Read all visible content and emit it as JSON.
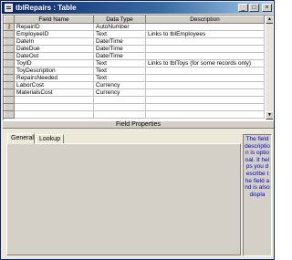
{
  "window": {
    "title": "tblRepairs : Table",
    "min_glyph": "_",
    "max_glyph": "□",
    "close_glyph": "×"
  },
  "grid": {
    "columns": [
      "Field Name",
      "Data Type",
      "Description"
    ],
    "rows": [
      {
        "name": "RepairID",
        "type": "AutoNumber",
        "desc": "",
        "key": true
      },
      {
        "name": "EmployeeID",
        "type": "Text",
        "desc": "Links to tblEmployees",
        "key": false
      },
      {
        "name": "DateIn",
        "type": "Date/Time",
        "desc": "",
        "key": false
      },
      {
        "name": "DateDue",
        "type": "Date/Time",
        "desc": "",
        "key": false
      },
      {
        "name": "DateOut",
        "type": "Date/Time",
        "desc": "",
        "key": false
      },
      {
        "name": "ToyID",
        "type": "Text",
        "desc": "Links to tblToys (for some records only)",
        "key": false
      },
      {
        "name": "ToyDescription",
        "type": "Text",
        "desc": "",
        "key": false
      },
      {
        "name": "RepairsNeeded",
        "type": "Text",
        "desc": "",
        "key": false
      },
      {
        "name": "LaborCost",
        "type": "Currency",
        "desc": "",
        "key": false
      },
      {
        "name": "MaterialsCost",
        "type": "Currency",
        "desc": "",
        "key": false
      },
      {
        "name": "",
        "type": "",
        "desc": "",
        "key": false
      },
      {
        "name": "",
        "type": "",
        "desc": "",
        "key": false
      },
      {
        "name": "",
        "type": "",
        "desc": "",
        "key": false
      }
    ]
  },
  "field_properties": {
    "header": "Field Properties",
    "tabs": [
      {
        "label": "General",
        "active": true
      },
      {
        "label": "Lookup",
        "active": false
      }
    ],
    "help_text": "The field description is optional. It helps you describe the field and is also displa"
  }
}
